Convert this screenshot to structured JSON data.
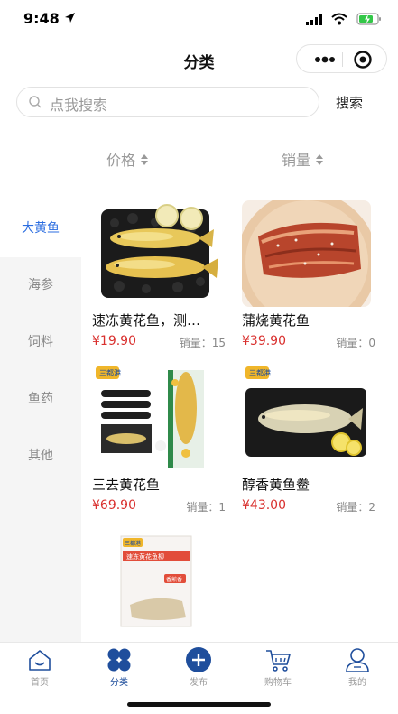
{
  "status_bar": {
    "time": "9:48"
  },
  "navbar": {
    "title": "分类"
  },
  "search": {
    "placeholder": "点我搜索",
    "button_label": "搜索"
  },
  "sort": {
    "price_label": "价格",
    "sales_label": "销量"
  },
  "sidebar": {
    "items": [
      {
        "label": "大黄鱼",
        "active": true
      },
      {
        "label": "海参",
        "active": false
      },
      {
        "label": "饲料",
        "active": false
      },
      {
        "label": "鱼药",
        "active": false
      },
      {
        "label": "其他",
        "active": false
      }
    ]
  },
  "products": [
    {
      "name": "速冻黄花鱼，测…",
      "price": "¥19.90",
      "sales": "销量：15"
    },
    {
      "name": "蒲烧黄花鱼",
      "price": "¥39.90",
      "sales": "销量：0"
    },
    {
      "name": "三去黄花鱼",
      "price": "¥69.90",
      "sales": "销量：1"
    },
    {
      "name": "醇香黄鱼鲞",
      "price": "¥43.00",
      "sales": "销量：2"
    },
    {
      "name": "",
      "price": "",
      "sales": ""
    }
  ],
  "product5_package": {
    "brand": "三都港",
    "title": "速冻黄花鱼柳",
    "badge": "香煎香"
  },
  "product3_package": {
    "brand": "三都港"
  },
  "product4_package": {
    "brand": "三都港"
  },
  "tabbar": {
    "items": [
      {
        "label": "首页",
        "icon": "home-icon",
        "active": false
      },
      {
        "label": "分类",
        "icon": "category-icon",
        "active": true
      },
      {
        "label": "发布",
        "icon": "publish-icon",
        "active": false
      },
      {
        "label": "购物车",
        "icon": "cart-icon",
        "active": false
      },
      {
        "label": "我的",
        "icon": "profile-icon",
        "active": false
      }
    ]
  },
  "colors": {
    "accent": "#2b6de0",
    "price": "#d9302e",
    "tab_active": "#1f4e9c"
  }
}
